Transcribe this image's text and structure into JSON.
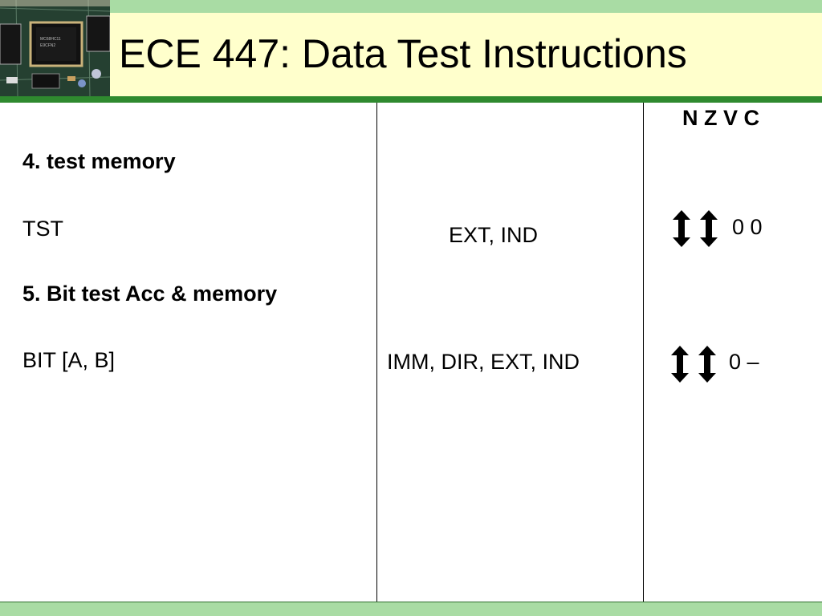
{
  "header": {
    "title": "ECE 447: Data Test Instructions"
  },
  "columns": {
    "flags_header": "N Z V C"
  },
  "rows": [
    {
      "section": "4. test  memory",
      "mnemonic": "TST",
      "modes": "EXT, IND",
      "flags_text": "0 0"
    },
    {
      "section": "5. Bit test    Acc & memory",
      "mnemonic": "BIT [A, B]",
      "modes": "IMM, DIR, EXT, IND",
      "flags_text": "0  –"
    }
  ],
  "colors": {
    "strip_green": "#a9dca4",
    "title_bg": "#ffffcc",
    "underline_green": "#2f8a2f"
  },
  "icons": [
    "up-down-arrow-icon"
  ]
}
